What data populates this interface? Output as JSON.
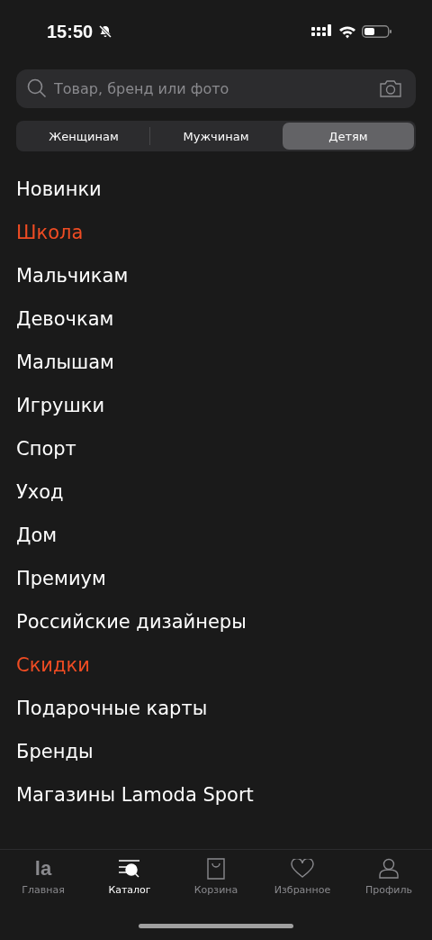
{
  "status_bar": {
    "time": "15:50",
    "silent": true
  },
  "search": {
    "placeholder": "Товар, бренд или фото"
  },
  "tabs": [
    {
      "label": "Женщинам",
      "selected": false
    },
    {
      "label": "Мужчинам",
      "selected": false
    },
    {
      "label": "Детям",
      "selected": true
    }
  ],
  "menu": [
    {
      "label": "Новинки",
      "accent": false
    },
    {
      "label": "Школа",
      "accent": true
    },
    {
      "label": "Мальчикам",
      "accent": false
    },
    {
      "label": "Девочкам",
      "accent": false
    },
    {
      "label": "Малышам",
      "accent": false
    },
    {
      "label": "Игрушки",
      "accent": false
    },
    {
      "label": "Спорт",
      "accent": false
    },
    {
      "label": "Уход",
      "accent": false
    },
    {
      "label": "Дом",
      "accent": false
    },
    {
      "label": "Премиум",
      "accent": false
    },
    {
      "label": "Российские дизайнеры",
      "accent": false
    },
    {
      "label": "Скидки",
      "accent": true
    },
    {
      "label": "Подарочные карты",
      "accent": false
    },
    {
      "label": "Бренды",
      "accent": false
    },
    {
      "label": "Магазины Lamoda Sport",
      "accent": false
    }
  ],
  "bottom_nav": [
    {
      "kind": "logo",
      "logo_text": "la",
      "label": "Главная",
      "selected": false
    },
    {
      "kind": "catalog",
      "label": "Каталог",
      "selected": true
    },
    {
      "kind": "bag",
      "label": "Корзина",
      "selected": false
    },
    {
      "kind": "heart",
      "label": "Избранное",
      "selected": false
    },
    {
      "kind": "person",
      "label": "Профиль",
      "selected": false
    }
  ]
}
